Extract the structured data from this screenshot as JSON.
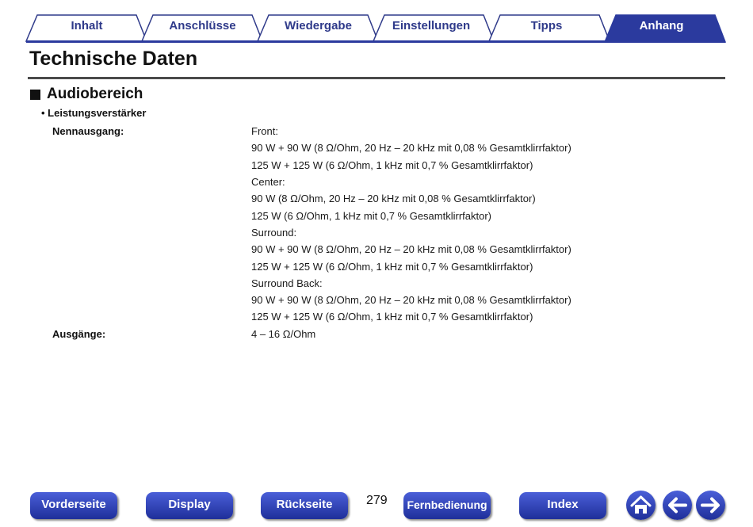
{
  "tabs": [
    {
      "label": "Inhalt"
    },
    {
      "label": "Anschlüsse"
    },
    {
      "label": "Wiedergabe"
    },
    {
      "label": "Einstellungen"
    },
    {
      "label": "Tipps"
    },
    {
      "label": "Anhang",
      "active": true
    }
  ],
  "page_title": "Technische Daten",
  "section_title": "Audiobereich",
  "subsection": "Leistungsverstärker",
  "specs": {
    "nennausgang_label": "Nennausgang:",
    "nennausgang_lines": [
      "Front:",
      "90 W + 90 W (8 Ω/Ohm, 20 Hz – 20 kHz mit 0,08 % Gesamtklirrfaktor)",
      "125 W + 125 W (6 Ω/Ohm, 1 kHz mit 0,7 % Gesamtklirrfaktor)",
      "Center:",
      "90 W (8 Ω/Ohm, 20 Hz – 20 kHz mit 0,08 % Gesamtklirrfaktor)",
      "125 W (6 Ω/Ohm, 1 kHz mit 0,7 % Gesamtklirrfaktor)",
      "Surround:",
      "90 W + 90 W (8 Ω/Ohm, 20 Hz – 20 kHz mit 0,08 % Gesamtklirrfaktor)",
      "125 W + 125 W (6 Ω/Ohm, 1 kHz mit 0,7 % Gesamtklirrfaktor)",
      "Surround Back:",
      "90 W + 90 W (8 Ω/Ohm, 20 Hz – 20 kHz mit 0,08 % Gesamtklirrfaktor)",
      "125 W + 125 W (6 Ω/Ohm, 1 kHz mit 0,7 % Gesamtklirrfaktor)"
    ],
    "ausgaenge_label": "Ausgänge:",
    "ausgaenge_value": "4 – 16 Ω/Ohm"
  },
  "footer": {
    "vorderseite": "Vorderseite",
    "display": "Display",
    "rueckseite": "Rückseite",
    "page_number": "279",
    "fernbedienung": "Fernbedienung",
    "index": "Index",
    "home_icon": "home-icon",
    "back_icon": "arrow-left-icon",
    "forward_icon": "arrow-right-icon"
  },
  "colors": {
    "tab_text": "#2f3a8a",
    "tab_active_bg": "#2b3a9e",
    "button_bg": "#2a3cae"
  }
}
